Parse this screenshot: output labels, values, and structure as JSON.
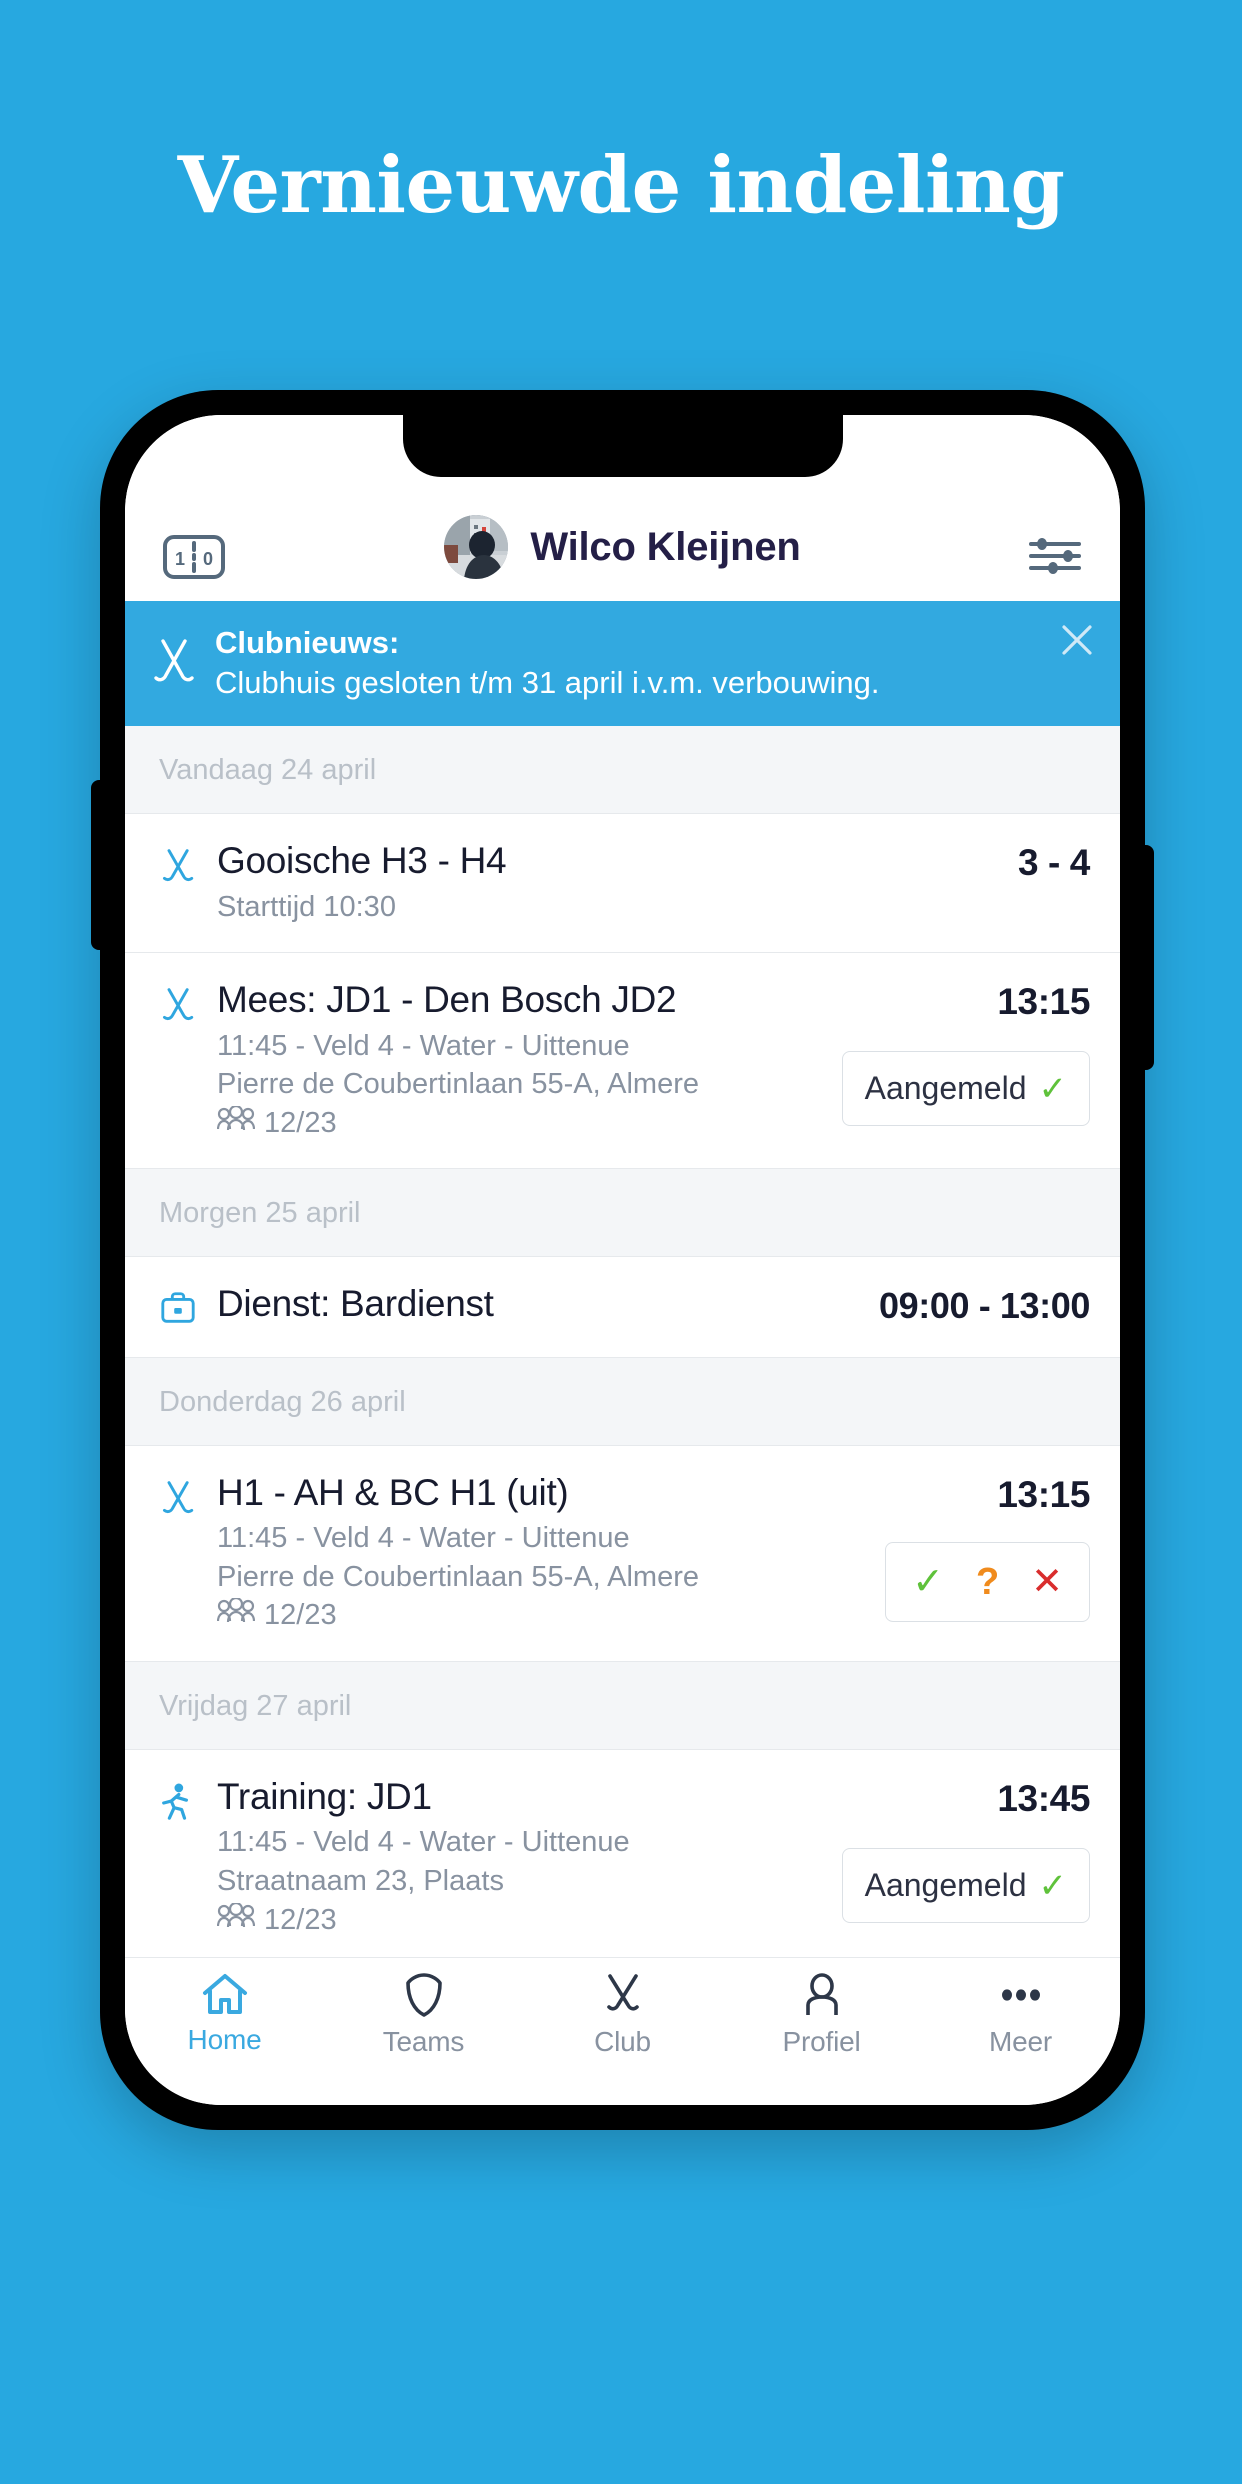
{
  "promo": {
    "headline": "Vernieuwde indeling",
    "background_color": "#27a8e0"
  },
  "app": {
    "header": {
      "score_icon": "scoreboard-icon",
      "score_left": "1",
      "score_right": "0",
      "avatar": "user-avatar",
      "user_name": "Wilco Kleijnen",
      "filter_icon": "sliders-icon"
    },
    "banner": {
      "icon": "crossed-hockey-sticks-icon",
      "title": "Clubnieuws:",
      "message": "Clubhuis gesloten t/m 31 april i.v.m. verbouwing.",
      "close_icon": "close-icon",
      "background_color": "#32a9e0"
    },
    "agenda": [
      {
        "day_label": "Vandaag 24 april",
        "events": [
          {
            "icon": "crossed-hockey-sticks-icon",
            "title": "Gooische H3 - H4",
            "lines": [
              "Starttijd 10:30"
            ],
            "count": null,
            "time": "3 - 4",
            "action": null
          }
        ]
      },
      {
        "day_label": null,
        "events": [
          {
            "icon": "crossed-hockey-sticks-icon",
            "title": "Mees: JD1 - Den Bosch JD2",
            "lines": [
              "11:45 - Veld 4 - Water - Uittenue",
              "Pierre de Coubertinlaan 55-A, Almere"
            ],
            "count": "12/23",
            "time": "13:15",
            "action": {
              "type": "pill",
              "label": "Aangemeld",
              "tick": "✓"
            }
          }
        ]
      },
      {
        "day_label": "Morgen 25 april",
        "events": [
          {
            "icon": "briefcase-icon",
            "title": "Dienst: Bardienst",
            "lines": [],
            "count": null,
            "time": "09:00 - 13:00",
            "action": null
          }
        ]
      },
      {
        "day_label": "Donderdag 26 april",
        "events": [
          {
            "icon": "crossed-hockey-sticks-icon",
            "title": "H1 - AH & BC H1 (uit)",
            "lines": [
              "11:45 - Veld 4 - Water - Uittenue",
              "Pierre de Coubertinlaan 55-A, Almere"
            ],
            "count": "12/23",
            "time": "13:15",
            "action": {
              "type": "rsvp",
              "yes": "✓",
              "maybe": "?",
              "no": "✕"
            }
          }
        ]
      },
      {
        "day_label": "Vrijdag 27 april",
        "events": [
          {
            "icon": "running-person-icon",
            "title": "Training: JD1",
            "lines": [
              "11:45 - Veld 4 - Water - Uittenue",
              "Straatnaam 23, Plaats"
            ],
            "count": "12/23",
            "time": "13:45",
            "action": {
              "type": "pill",
              "label": "Aangemeld",
              "tick": "✓"
            }
          }
        ]
      }
    ],
    "tabs": [
      {
        "id": "home",
        "label": "Home",
        "icon": "home-icon",
        "active": true
      },
      {
        "id": "teams",
        "label": "Teams",
        "icon": "shield-icon",
        "active": false
      },
      {
        "id": "club",
        "label": "Club",
        "icon": "crossed-hockey-sticks-icon",
        "active": false
      },
      {
        "id": "profiel",
        "label": "Profiel",
        "icon": "person-icon",
        "active": false
      },
      {
        "id": "meer",
        "label": "Meer",
        "icon": "ellipsis-icon",
        "active": false
      }
    ],
    "colors": {
      "accent_blue": "#3aa9e0",
      "text_dark": "#171b2e",
      "text_muted": "#8892a0",
      "day_label": "#b9c0c8",
      "green": "#5fc23b",
      "orange": "#f08b1d",
      "red": "#d92d2d"
    }
  }
}
